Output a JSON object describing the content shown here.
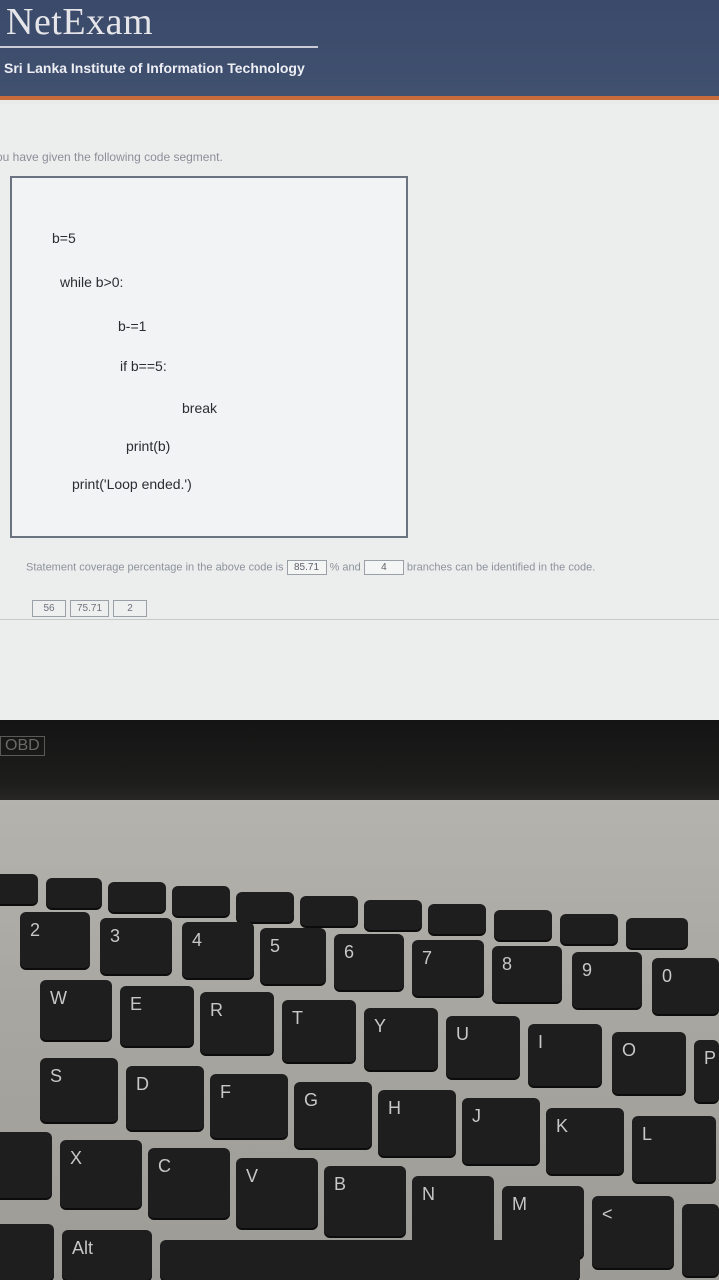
{
  "header": {
    "title": "NetExam",
    "subtitle": "Sri Lanka Institute of Information Technology"
  },
  "question": {
    "intro": "ou have given the following code segment.",
    "code": [
      "b=5",
      "while b>0:",
      "b-=1",
      "if b==5:",
      "break",
      "print(b)",
      "print('Loop ended.')"
    ],
    "statement_pre": "Statement coverage percentage in the above code is",
    "answer1": "85.71",
    "statement_mid": "% and",
    "answer2": "4",
    "statement_post": "branches can be identified in the code.",
    "choices": [
      "56",
      "75.71",
      "2"
    ]
  },
  "laptop": {
    "model_badge": "OBD",
    "keys": [
      "2",
      "3",
      "4",
      "5",
      "6",
      "7",
      "8",
      "9",
      "0",
      "W",
      "E",
      "R",
      "T",
      "Y",
      "U",
      "I",
      "O",
      "P",
      "S",
      "D",
      "F",
      "G",
      "H",
      "J",
      "K",
      "L",
      "X",
      "C",
      "V",
      "B",
      "N",
      "M",
      "<",
      "Alt"
    ]
  }
}
